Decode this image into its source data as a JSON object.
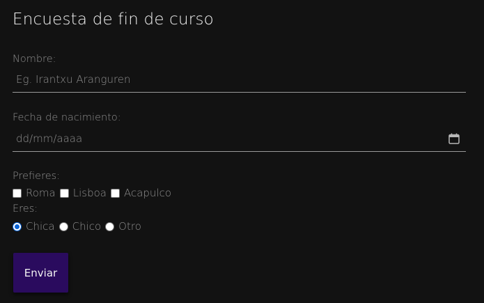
{
  "form": {
    "title": "Encuesta de fin de curso",
    "name": {
      "label": "Nombre:",
      "placeholder": "Eg. Irantxu Aranguren",
      "value": ""
    },
    "birthdate": {
      "label": "Fecha de nacimiento:",
      "placeholder": "dd/mm/aaaa",
      "icon": "calendar-icon"
    },
    "prefer": {
      "label": "Prefieres:",
      "options": [
        {
          "label": "Roma",
          "checked": false
        },
        {
          "label": "Lisboa",
          "checked": false
        },
        {
          "label": "Acapulco",
          "checked": false
        }
      ]
    },
    "gender": {
      "label": "Eres:",
      "options": [
        {
          "label": "Chica",
          "checked": true
        },
        {
          "label": "Chico",
          "checked": false
        },
        {
          "label": "Otro",
          "checked": false
        }
      ]
    },
    "submit_label": "Enviar"
  },
  "colors": {
    "background": "#121212",
    "button": "#2a0b5e",
    "radio_accent": "#0a64d8"
  }
}
